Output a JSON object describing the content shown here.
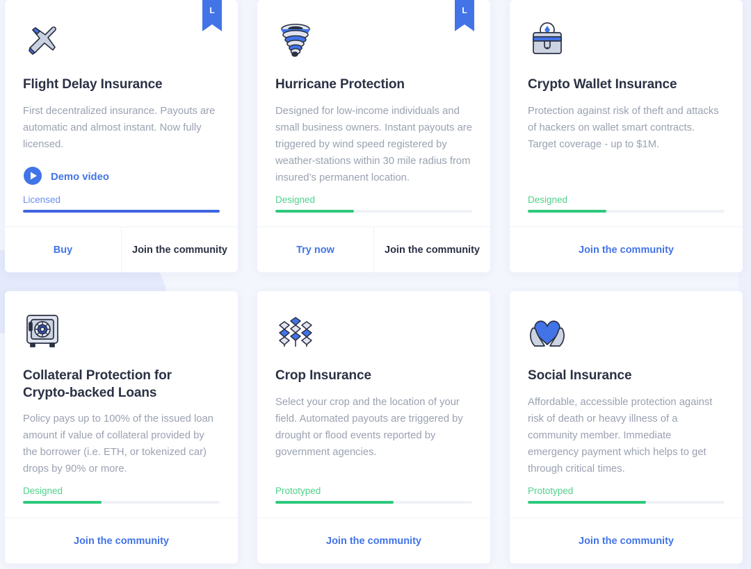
{
  "theme": {
    "page_background": "#f4f6fd",
    "card_background": "#ffffff",
    "accent_blue": "#4274e8",
    "progress_blue": "#3f63e0",
    "progress_green": "#2ec97c",
    "label_green": "#4fd18b",
    "label_blue": "#6b8ff0",
    "title_color": "#2b3144",
    "body_color": "#9aa1b1"
  },
  "cards": [
    {
      "id": "flight-delay-insurance",
      "ribbon": "L",
      "icon": "crossed-airplanes-icon",
      "title": "Flight Delay Insurance",
      "description": "First decentralized insurance. Payouts are automatic and almost instant. Now fully licensed.",
      "demo_link": "Demo video",
      "status_label": "Licensed",
      "status_color": "blue",
      "progress_percent": 100,
      "footer": [
        {
          "label": "Buy",
          "style": "blue"
        },
        {
          "label": "Join the community",
          "style": "dark"
        }
      ]
    },
    {
      "id": "hurricane-protection",
      "ribbon": "L",
      "icon": "tornado-icon",
      "title": "Hurricane Protection",
      "description": "Designed for low-income individuals and small business owners. Instant payouts are triggered by wind speed registered by weather-stations within 30 mile radius from insured’s permanent location.",
      "demo_link": null,
      "status_label": "Designed",
      "status_color": "green",
      "progress_percent": 40,
      "footer": [
        {
          "label": "Try now",
          "style": "blue"
        },
        {
          "label": "Join the community",
          "style": "dark"
        }
      ]
    },
    {
      "id": "crypto-wallet-insurance",
      "ribbon": null,
      "icon": "crypto-wallet-icon",
      "title": "Crypto Wallet Insurance",
      "description": "Protection against risk of theft and attacks of hackers on wallet smart contracts. Target coverage - up to $1M.",
      "demo_link": null,
      "status_label": "Designed",
      "status_color": "green",
      "progress_percent": 40,
      "footer": [
        {
          "label": "Join the community",
          "style": "blue"
        }
      ]
    },
    {
      "id": "collateral-protection-crypto-backed-loans",
      "ribbon": null,
      "icon": "safe-vault-icon",
      "title": "Collateral Protection for Crypto-backed Loans",
      "description": "Policy pays up to 100% of the issued loan amount if value of collateral provided by the borrower (i.e. ETH, or tokenized car) drops by 90% or more.",
      "demo_link": null,
      "status_label": "Designed",
      "status_color": "green",
      "progress_percent": 40,
      "footer": [
        {
          "label": "Join the community",
          "style": "blue"
        }
      ]
    },
    {
      "id": "crop-insurance",
      "ribbon": null,
      "icon": "wheat-stalks-icon",
      "title": "Crop Insurance",
      "description": "Select your crop and the location of your field. Automated payouts are triggered by drought or flood events reported by government agencies.",
      "demo_link": null,
      "status_label": "Prototyped",
      "status_color": "green",
      "progress_percent": 60,
      "footer": [
        {
          "label": "Join the community",
          "style": "blue"
        }
      ]
    },
    {
      "id": "social-insurance",
      "ribbon": null,
      "icon": "heart-in-hands-icon",
      "title": "Social Insurance",
      "description": "Affordable, accessible protection against risk of death or heavy illness of a community member. Immediate emergency payment which helps to get through critical times.",
      "demo_link": null,
      "status_label": "Prototyped",
      "status_color": "green",
      "progress_percent": 60,
      "footer": [
        {
          "label": "Join the community",
          "style": "blue"
        }
      ]
    }
  ]
}
